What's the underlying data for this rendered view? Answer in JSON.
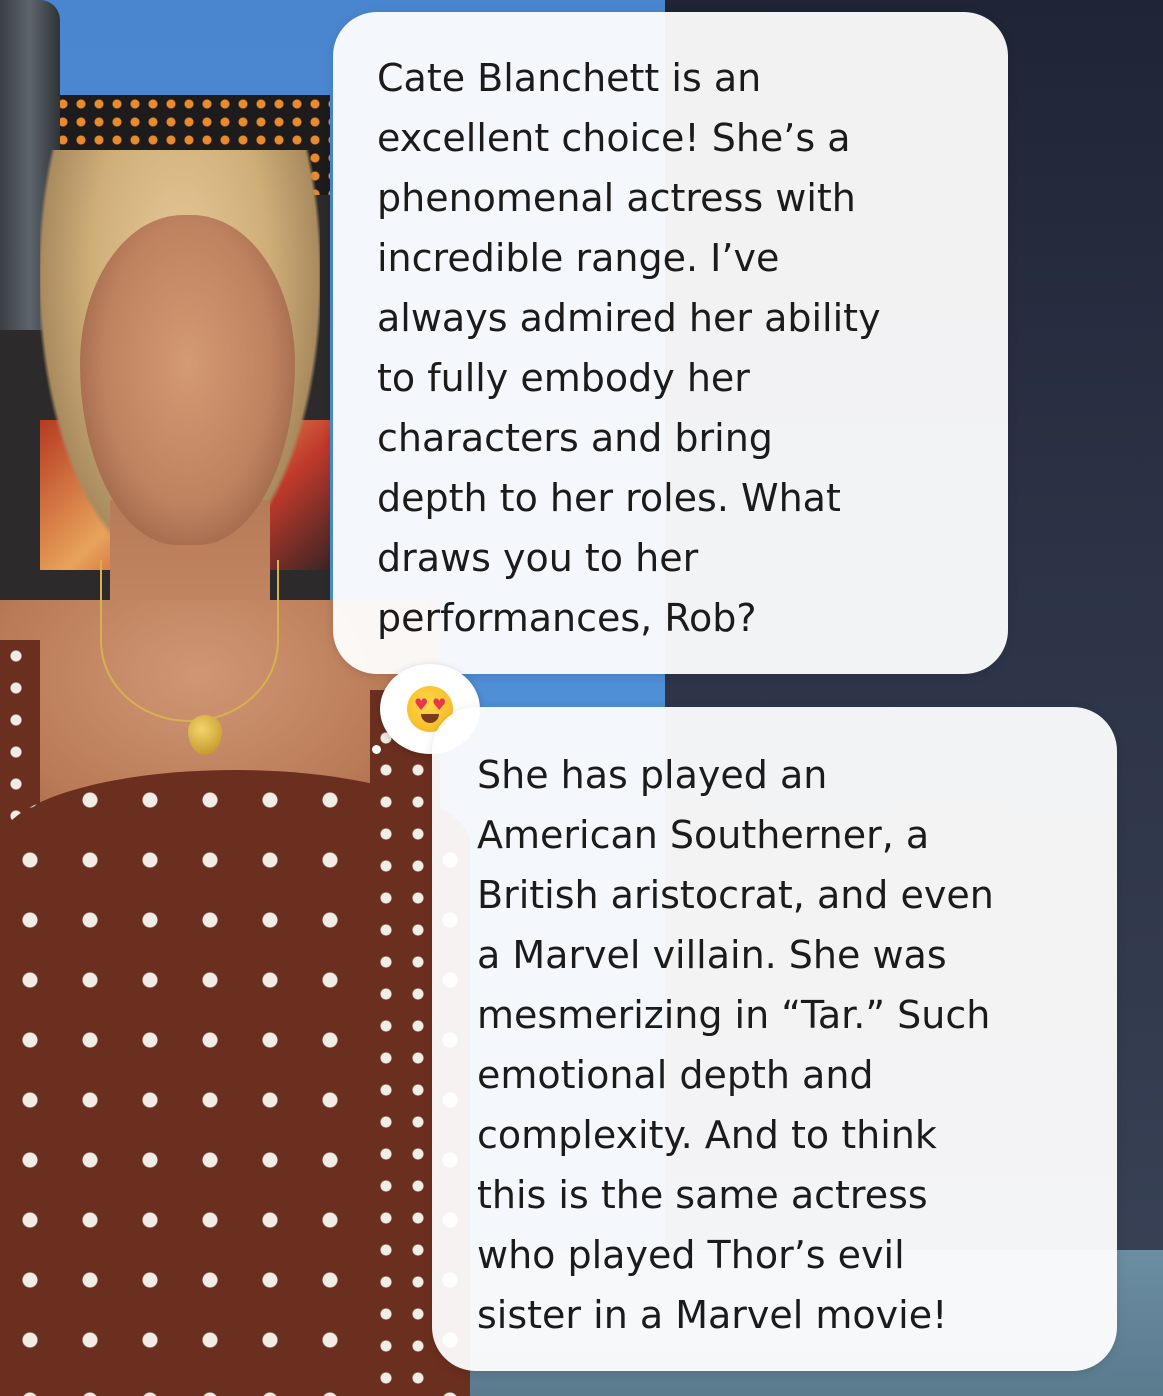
{
  "chat": {
    "messages": [
      {
        "sender": "ai",
        "lines": [
          "Cate Blanchett is an",
          "excellent choice! She’s a",
          "phenomenal actress with",
          "incredible range. I’ve",
          "always admired her ability",
          "to fully embody her",
          "characters and bring",
          "depth to her roles. What",
          "draws you to her",
          "performances, Rob?"
        ],
        "reaction": {
          "icon": "heart-eyes-emoji-icon"
        }
      },
      {
        "sender": "user",
        "lines": [
          "She has played an",
          "American Southerner, a",
          "British aristocrat, and even",
          "a Marvel villain. She was",
          "mesmerizing in “Tar.” Such",
          "emotional depth and",
          "complexity. And to think",
          "this is the same actress",
          "who played Thor’s evil",
          "sister in a Marvel movie!"
        ]
      }
    ]
  },
  "colors": {
    "bubble_bg": "#ffffff",
    "text": "#1b1b1b",
    "dress": "#6b2f1f",
    "background_blue": "#4a86cf"
  }
}
